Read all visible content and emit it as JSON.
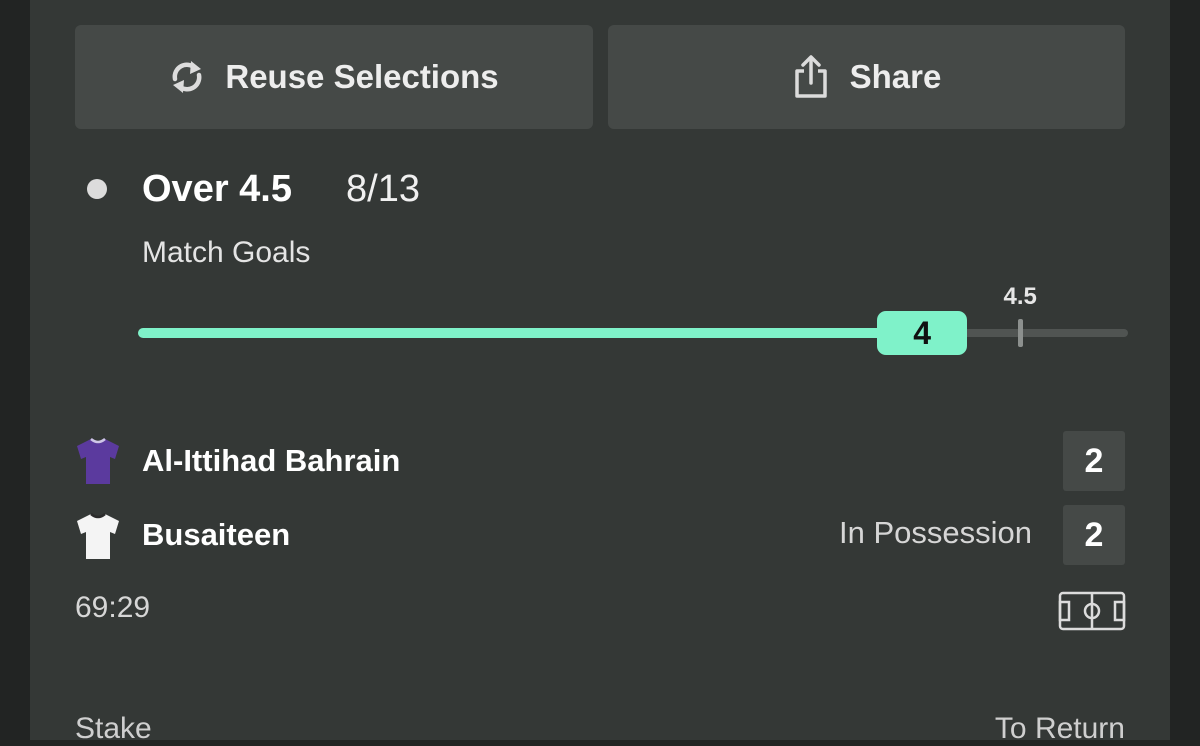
{
  "actions": {
    "reuse_label": "Reuse Selections",
    "share_label": "Share"
  },
  "selection": {
    "name": "Over 4.5",
    "odds": "8/13",
    "market": "Match Goals"
  },
  "goals_progress": {
    "current": 4,
    "current_label": "4",
    "target": 4.5,
    "target_label": "4.5",
    "scale_max": 5.05
  },
  "match": {
    "home": {
      "name": "Al-Ittihad Bahrain",
      "score": "2",
      "shirt_color": "#5b3a9e",
      "shirt_icon": "purple-shirt-icon"
    },
    "away": {
      "name": "Busaiteen",
      "score": "2",
      "shirt_color": "#f4f4f4",
      "shirt_icon": "white-shirt-icon",
      "status": "In Possession"
    },
    "clock": "69:29",
    "pitch_icon": "pitch-icon"
  },
  "footer": {
    "stake_label": "Stake",
    "return_label": "To Return"
  },
  "colors": {
    "accent": "#7ff2c9",
    "card_bg": "#343836",
    "button_bg": "#454947"
  }
}
